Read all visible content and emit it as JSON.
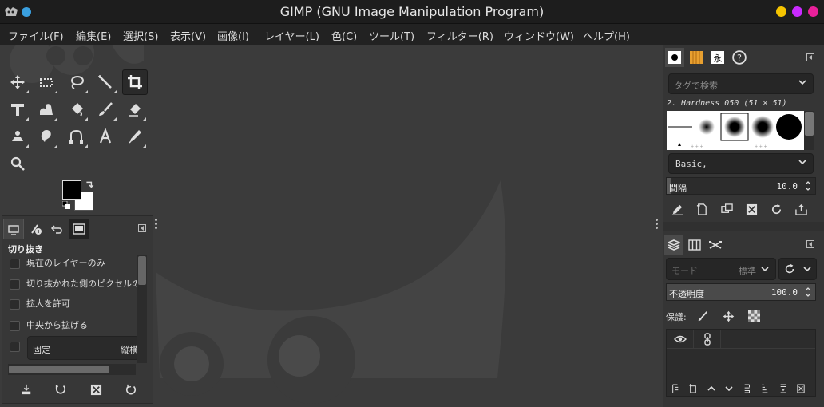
{
  "window": {
    "title": "GIMP (GNU Image Manipulation Program)",
    "controls": [
      "#f5c400",
      "#c92aff",
      "#e8209a"
    ]
  },
  "menu": [
    "ファイル(F)",
    "編集(E)",
    "選択(S)",
    "表示(V)",
    "画像(I)",
    "レイヤー(L)",
    "色(C)",
    "ツール(T)",
    "フィルター(R)",
    "ウィンドウ(W)",
    "ヘルプ(H)"
  ],
  "toolbox": {
    "tools": [
      {
        "name": "move-tool",
        "icon": "move-icon"
      },
      {
        "name": "rect-select-tool",
        "icon": "rect-select-icon"
      },
      {
        "name": "lasso-tool",
        "icon": "lasso-icon"
      },
      {
        "name": "fuzzy-select-tool",
        "icon": "wand-icon"
      },
      {
        "name": "crop-tool",
        "icon": "crop-icon",
        "active": true
      },
      {
        "name": "transform-tool",
        "icon": "unified-transform-icon"
      },
      {
        "name": "warp-tool",
        "icon": "warp-icon"
      },
      {
        "name": "bucket-fill-tool",
        "icon": "bucket-icon"
      },
      {
        "name": "paintbrush-tool",
        "icon": "brush-icon"
      },
      {
        "name": "eraser-tool",
        "icon": "eraser-icon"
      },
      {
        "name": "clone-tool",
        "icon": "clone-icon"
      },
      {
        "name": "smudge-tool",
        "icon": "smudge-icon"
      },
      {
        "name": "paths-tool",
        "icon": "paths-icon"
      },
      {
        "name": "text-tool",
        "icon": "text-icon"
      },
      {
        "name": "color-picker-tool",
        "icon": "picker-icon"
      },
      {
        "name": "zoom-tool",
        "icon": "zoom-icon"
      }
    ],
    "fg_color": "#000000",
    "bg_color": "#ffffff"
  },
  "tool_options": {
    "title": "切り抜き",
    "options": [
      "現在のレイヤーのみ",
      "切り抜かれた側のピクセルの",
      "拡大を許可",
      "中央から拡げる"
    ],
    "fixed_label": "固定",
    "fixed_value": "縦横"
  },
  "brushes": {
    "tag_placeholder": "タグで検索",
    "brush_name": "2. Hardness 050 (51 × 51)",
    "preset": "Basic,",
    "spacing_label": "間隔",
    "spacing_value": "10.0"
  },
  "layers": {
    "mode_label": "モード",
    "mode_value": "標準",
    "opacity_label": "不透明度",
    "opacity_value": "100.0",
    "lock_label": "保護:"
  }
}
